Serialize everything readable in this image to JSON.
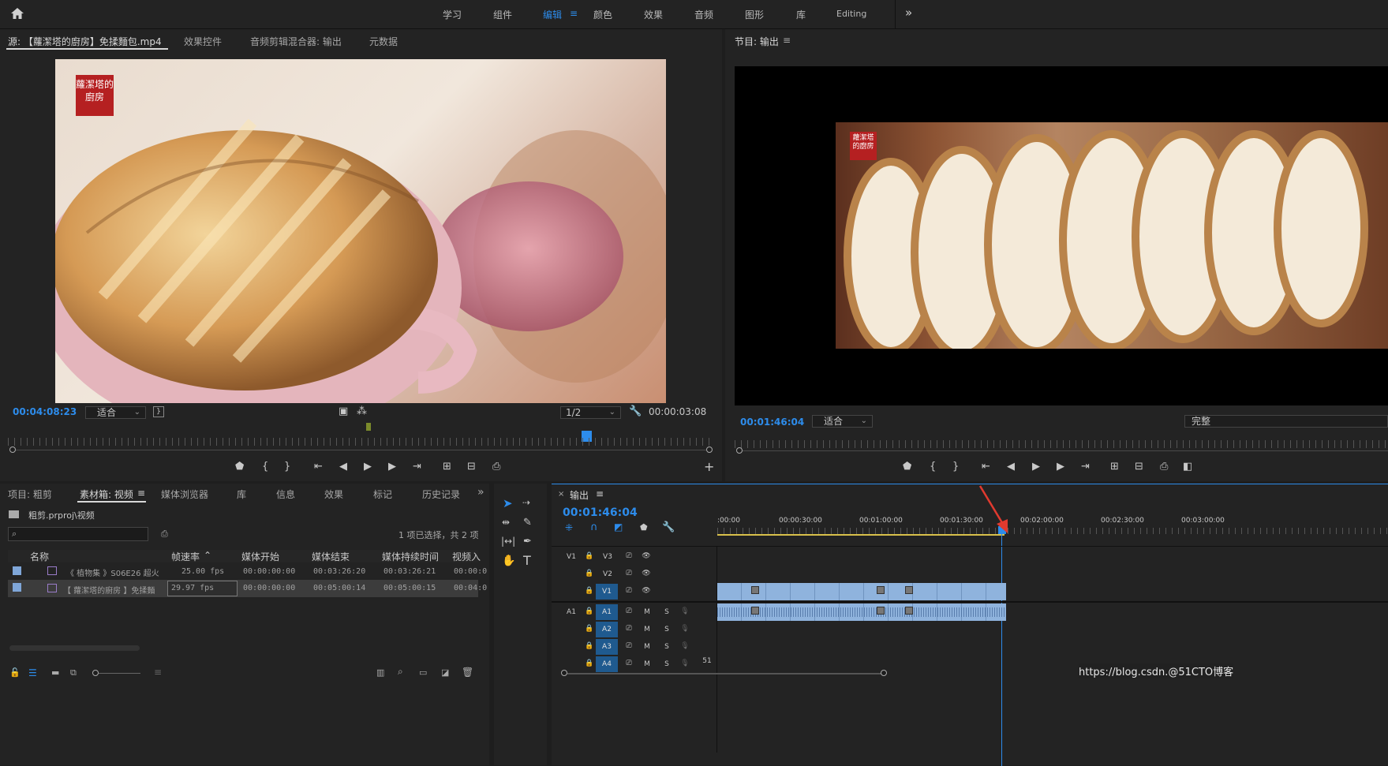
{
  "workspace": {
    "tabs": [
      "学习",
      "组件",
      "编辑",
      "颜色",
      "效果",
      "音频",
      "图形",
      "库",
      "Editing"
    ],
    "active": "编辑"
  },
  "source": {
    "tabs": [
      "源: 【蘿潔塔的廚房】免揉麵包.mp4",
      "效果控件",
      "音频剪辑混合器: 输出",
      "元数据"
    ],
    "menu_icon": "≡",
    "timecode_left": "00:04:08:23",
    "fit": "适合",
    "resolution": "1/2",
    "timecode_right": "00:00:03:08",
    "logo_text": "蘿潔塔的廚房"
  },
  "program": {
    "title": "节目: 输出",
    "timecode": "00:01:46:04",
    "fit": "适合",
    "quality": "完整",
    "logo_text": "蘿潔塔的廚房"
  },
  "project": {
    "tabs": [
      "项目: 粗剪",
      "素材箱: 视频",
      "媒体浏览器",
      "库",
      "信息",
      "效果",
      "标记",
      "历史记录"
    ],
    "path": "粗剪.prproj\\视频",
    "search_placeholder": "",
    "selection_info": "1 项已选择，共 2 项",
    "columns": [
      "名称",
      "帧速率",
      "媒体开始",
      "媒体结束",
      "媒体持续时间",
      "视频入"
    ],
    "rows": [
      {
        "name": "《 植物集 》S06E26 超火",
        "fps": "25.00 fps",
        "start": "00:00:00:00",
        "end": "00:03:26:20",
        "dur": "00:03:26:21",
        "vin": "00:00:0"
      },
      {
        "name": "【 蘿潔塔的廚房 】免揉麵",
        "fps": "29.97 fps",
        "start": "00:00:00:00",
        "end": "00:05:00:14",
        "dur": "00:05:00:15",
        "vin": "00:04:0"
      }
    ]
  },
  "timeline": {
    "title": "输出",
    "timecode": "00:01:46:04",
    "ruler": [
      ":00:00",
      "00:00:30:00",
      "00:01:00:00",
      "00:01:30:00",
      "00:02:00:00",
      "00:02:30:00",
      "00:03:00:00"
    ],
    "video_tracks": [
      {
        "src": "V1",
        "name": "V3",
        "active": false
      },
      {
        "src": "",
        "name": "V2",
        "active": false
      },
      {
        "src": "",
        "name": "V1",
        "active": true
      }
    ],
    "audio_tracks": [
      {
        "src": "A1",
        "name": "A1",
        "active": true
      },
      {
        "src": "",
        "name": "A2",
        "active": true
      },
      {
        "src": "",
        "name": "A3",
        "active": true
      },
      {
        "src": "",
        "name": "A4",
        "active": true
      }
    ],
    "m_label": "M",
    "s_label": "S",
    "bottom_counter": "51"
  },
  "watermark": "https://blog.csdn.@51CTO博客"
}
